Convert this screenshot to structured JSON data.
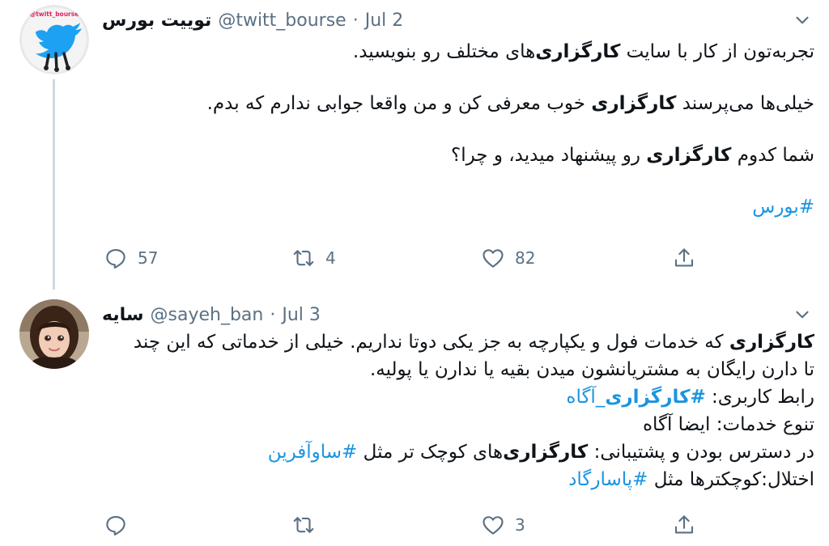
{
  "tweets": [
    {
      "display_name": "توییت بورس",
      "handle": "@twitt_bourse",
      "dot": "·",
      "date": "Jul 2",
      "avatar_text": "@twitt_bourse",
      "body": {
        "p1_a": "تجربه‌تون از کار با سایت ",
        "p1_b": "کارگزاری",
        "p1_c": "‌های مختلف رو بنویسید.",
        "p2_a": "خیلی‌ها می‌پرسند ",
        "p2_b": "کارگزاری",
        "p2_c": " خوب معرفی کن و من واقعا جوابی ندارم که بدم.",
        "p3_a": "شما کدوم ",
        "p3_b": "کارگزاری",
        "p3_c": " رو پیشنهاد میدید، و چرا؟",
        "hashtag": "#بورس"
      },
      "replies": "57",
      "retweets": "4",
      "likes": "82"
    },
    {
      "display_name": "سایه",
      "handle": "@sayeh_ban",
      "dot": "·",
      "date": "Jul 3",
      "body": {
        "l1_b": "کارگزاری",
        "l1_c": " که خدمات فول و یکپارچه به جز یکی دوتا نداریم. خیلی از خدماتی که این چند",
        "l2": "تا دارن رایگان به مشتریانشون میدن بقیه یا ندارن یا پولیه.",
        "l3_a": "رابط کاربری: ",
        "l3_link_bold": "#کارگزاری",
        "l3_link": "_آگاه",
        "l4": "تنوع خدمات: ایضا آگاه",
        "l5_a": "در دسترس بودن و پشتیبانی: ",
        "l5_b": "کارگزاری",
        "l5_c": "‌های کوچک تر مثل ",
        "l5_link": "#ساوآفرین",
        "l6_a": "اختلال:کوچکترها مثل ",
        "l6_link": "#پاسارگاد"
      },
      "replies": "",
      "retweets": "",
      "likes": "3"
    }
  ],
  "colors": {
    "link": "#1b95e0",
    "muted": "#5b7083",
    "twitter_blue": "#1da1f2"
  },
  "icons": [
    "reply-icon",
    "retweet-icon",
    "like-icon",
    "share-icon",
    "caret-down-icon"
  ]
}
